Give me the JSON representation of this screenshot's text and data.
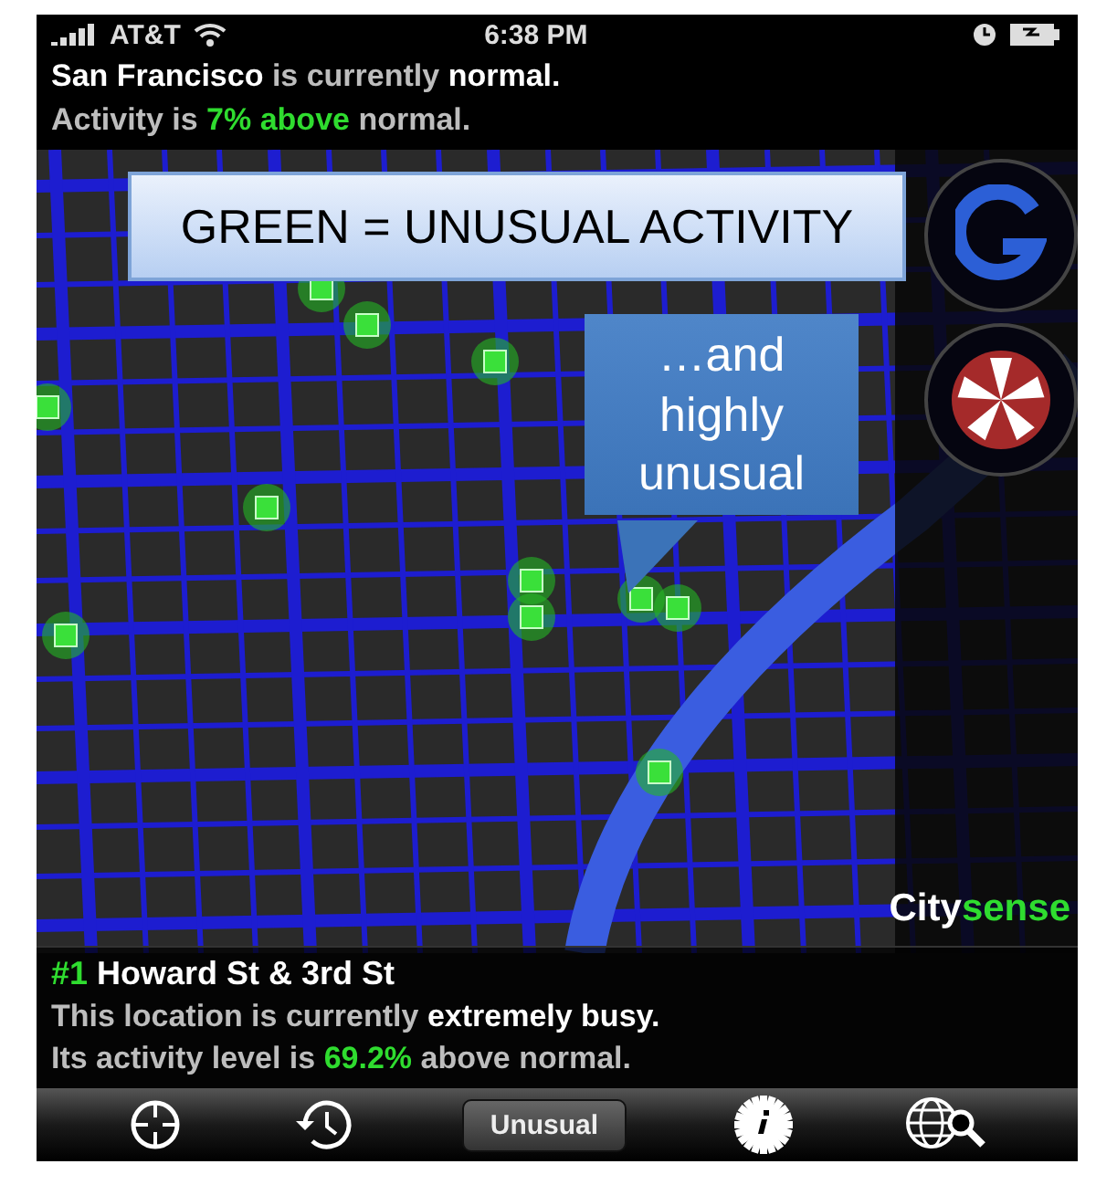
{
  "status_bar": {
    "carrier": "AT&T",
    "time": "6:38 PM"
  },
  "summary": [
    [
      {
        "text": "San Francisco",
        "kind": "strong"
      },
      {
        "text": " is currently ",
        "kind": "plain"
      },
      {
        "text": "normal.",
        "kind": "strong"
      }
    ],
    [
      {
        "text": "Activity is ",
        "kind": "plain"
      },
      {
        "text": "7% above",
        "kind": "highlight"
      },
      {
        "text": " normal.",
        "kind": "plain"
      }
    ]
  ],
  "annotations": [
    {
      "kind": "banner",
      "text": "GREEN = UNUSUAL ACTIVITY"
    },
    {
      "kind": "callout",
      "text": "…and highly unusual"
    }
  ],
  "logo": [
    {
      "text": "City",
      "kind": "strong"
    },
    {
      "text": "sense",
      "kind": "highlight"
    }
  ],
  "hotspot": {
    "title": [
      {
        "text": "#1",
        "kind": "highlight"
      },
      {
        "text": " Howard St & 3rd St",
        "kind": "strong"
      }
    ],
    "lines": [
      [
        {
          "text": "This location is currently ",
          "kind": "plain"
        },
        {
          "text": "extremely busy.",
          "kind": "strong"
        }
      ],
      [
        {
          "text": "Its activity level is ",
          "kind": "plain"
        },
        {
          "text": "69.2%",
          "kind": "highlight"
        },
        {
          "text": " above normal.",
          "kind": "plain"
        }
      ]
    ]
  },
  "toolbar": [
    {
      "kind": "crosshair"
    },
    {
      "kind": "history"
    },
    {
      "kind": "button",
      "label": "Unusual"
    },
    {
      "kind": "gear-info"
    },
    {
      "kind": "globe-search"
    }
  ]
}
